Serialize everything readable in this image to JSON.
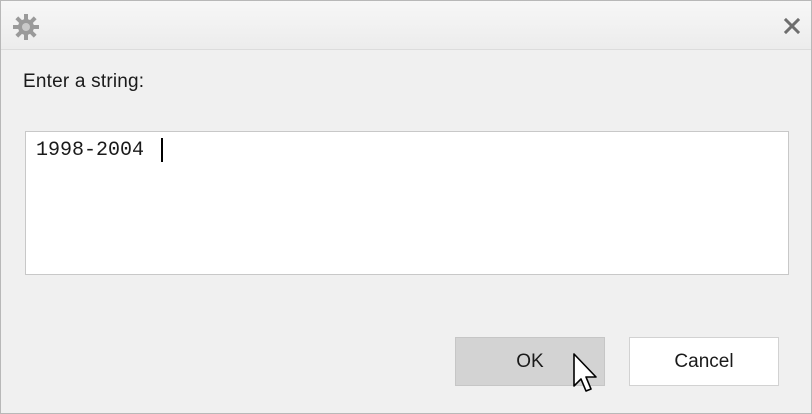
{
  "dialog": {
    "window_icon": "gear-icon",
    "close_icon": "close-icon",
    "prompt_label": "Enter a string:",
    "input_value": "1998-2004",
    "ok_label": "OK",
    "cancel_label": "Cancel"
  },
  "colors": {
    "background": "#f0f0f0",
    "ok_button": "#d3d3d3",
    "cancel_button": "#ffffff",
    "icon_gray": "#9a9a9a"
  }
}
